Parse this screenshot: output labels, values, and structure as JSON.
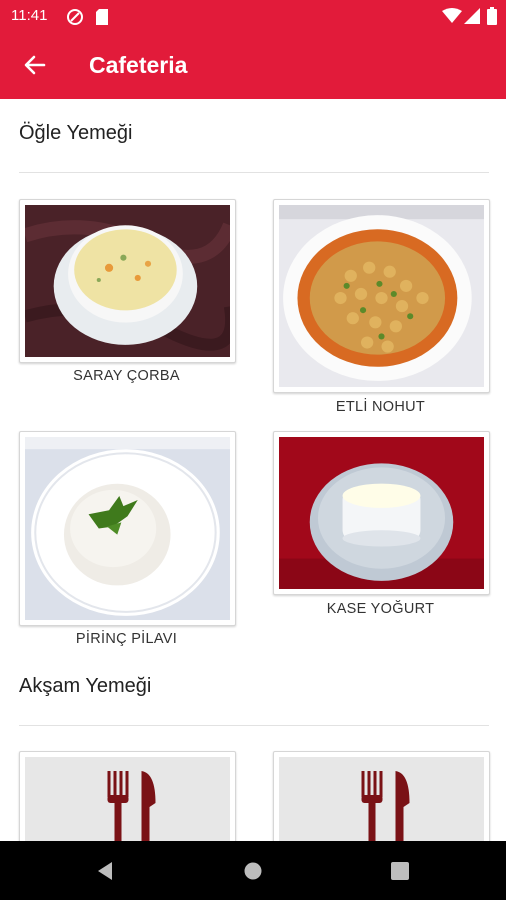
{
  "status_bar": {
    "time": "11:41"
  },
  "app_bar": {
    "title": "Cafeteria"
  },
  "sections": [
    {
      "title": "Öğle Yemeği",
      "items": [
        {
          "name": "SARAY ÇORBA"
        },
        {
          "name": "ETLİ NOHUT"
        },
        {
          "name": "PİRİNÇ PİLAVI"
        },
        {
          "name": "KASE YOĞURT"
        }
      ]
    },
    {
      "title": "Akşam Yemeği",
      "items": [
        {
          "name": "",
          "icon": "fork-knife-icon"
        },
        {
          "name": "",
          "icon": "fork-knife-icon"
        }
      ]
    }
  ],
  "colors": {
    "primary": "#e21b3a",
    "utensil": "#7a1216"
  }
}
